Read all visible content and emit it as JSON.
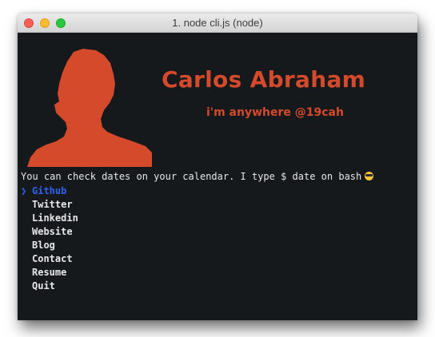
{
  "window": {
    "title": "1. node cli.js (node)"
  },
  "banner": {
    "name": "Carlos Abraham",
    "tagline": "i'm anywhere @19cah"
  },
  "prompt": {
    "text": "You can check dates on your calendar. I type $ date on bash",
    "emoji_icon": "sunglasses-face-icon"
  },
  "menu": {
    "pointer": "❯",
    "selected_index": 0,
    "items": [
      {
        "label": "Github"
      },
      {
        "label": "Twitter"
      },
      {
        "label": "Linkedin"
      },
      {
        "label": "Website"
      },
      {
        "label": "Blog"
      },
      {
        "label": "Contact"
      },
      {
        "label": "Resume"
      },
      {
        "label": "Quit"
      }
    ]
  },
  "colors": {
    "accent": "#d44a2b",
    "selection": "#2f62f0",
    "terminal_bg": "#16191c",
    "text": "#e8e8e8"
  }
}
